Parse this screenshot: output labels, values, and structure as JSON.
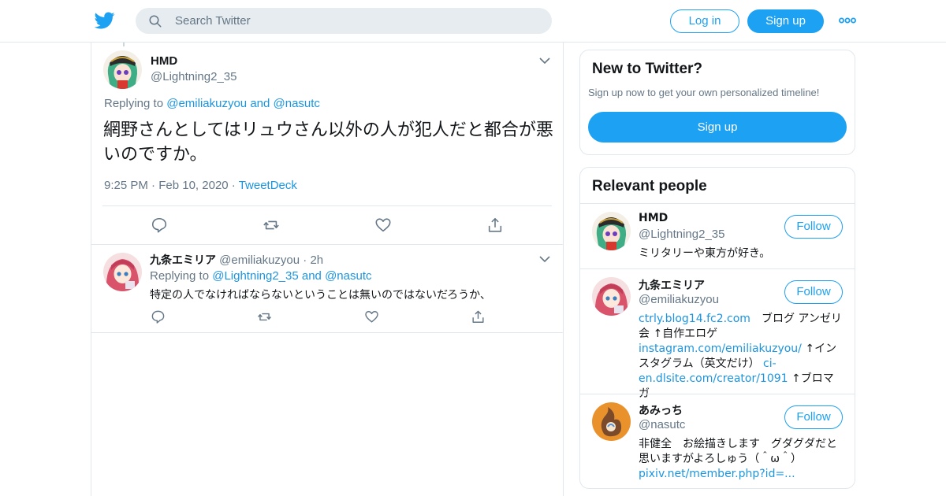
{
  "header": {
    "search_placeholder": "Search Twitter",
    "login_label": "Log in",
    "signup_label": "Sign up",
    "accent_color": "#1da1f2"
  },
  "main_tweet": {
    "name": "HMD",
    "handle": "@Lightning2_35",
    "replying_prefix": "Replying to",
    "replying_targets": "@emiliakuzyou and @nasutc",
    "text": "網野さんとしてはリュウさん以外の人が犯人だと都合が悪いのですか。",
    "time": "9:25 PM",
    "date": "Feb 10, 2020",
    "source": "TweetDeck"
  },
  "reply_tweet": {
    "name": "九条エミリア",
    "handle": "@emiliakuzyou",
    "time": "2h",
    "replying_prefix": "Replying to",
    "replying_targets": "@Lightning2_35 and @nasutc",
    "text": "特定の人でなければならないということは無いのではないだろうか、"
  },
  "new_to_twitter": {
    "title": "New to Twitter?",
    "subtitle": "Sign up now to get your own personalized timeline!",
    "button_label": "Sign up"
  },
  "relevant_people": {
    "title": "Relevant people",
    "follow_label": "Follow",
    "people": [
      {
        "name": "HMD",
        "handle": "@Lightning2_35",
        "bio": "ミリタリーや東方が好き。"
      },
      {
        "name": "九条エミリア",
        "handle": "@emiliakuzyou",
        "bio_link1": "ctrly.blog14.fc2.com",
        "bio_text1": "　ブログ アンゼリ会 ↑自作エロゲ",
        "bio_link2": "instagram.com/emiliakuzyou/",
        "bio_text2": " ↑インスタグラム（英文だけ）",
        "bio_link3": "ci-en.dlsite.com/creator/1091",
        "bio_text3": " ↑ブロマガ"
      },
      {
        "name": "あみっち",
        "handle": "@nasutc",
        "bio": "非健全　お絵描きします　グダグダだと思いますがよろしゅう（＾ω＾）",
        "bio_link": "pixiv.net/member.php?id=..."
      }
    ]
  }
}
